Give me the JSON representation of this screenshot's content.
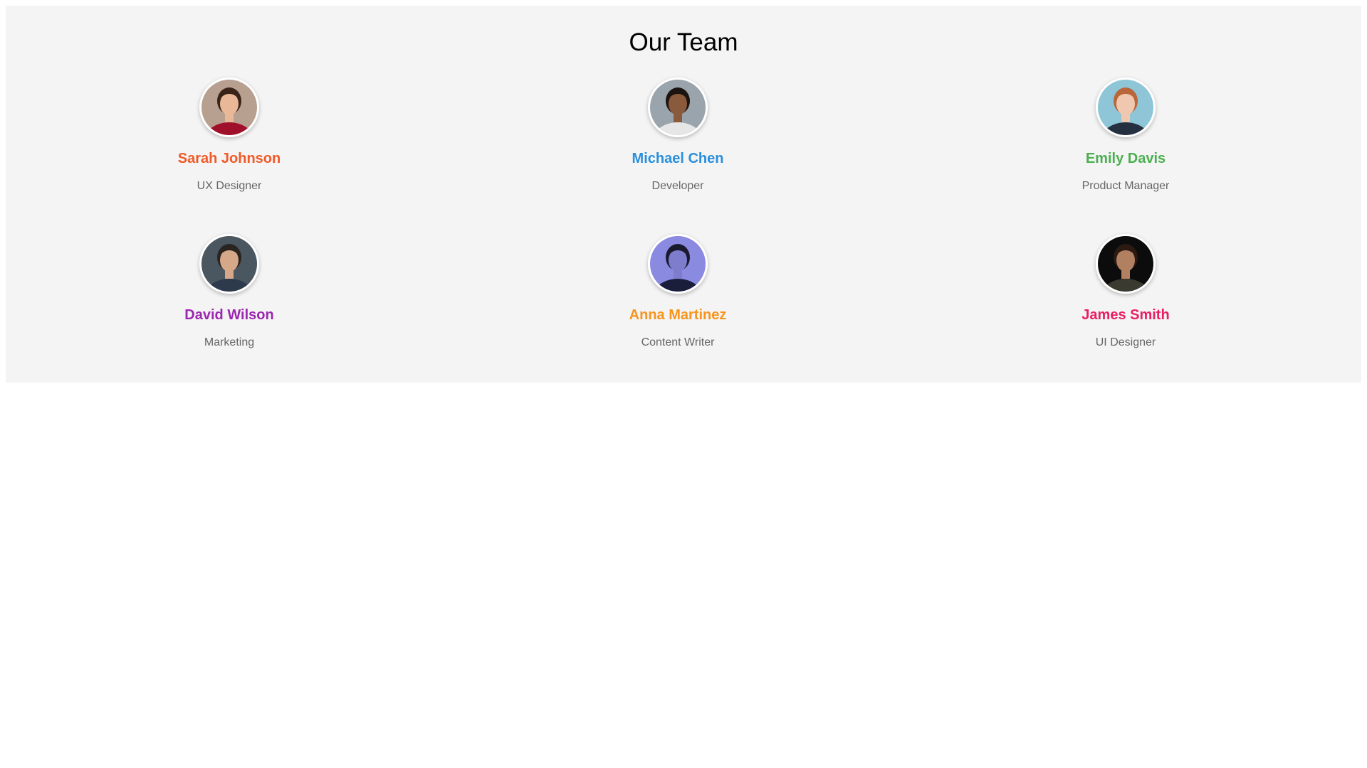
{
  "page": {
    "title": "Our Team"
  },
  "members": [
    {
      "name": "Sarah Johnson",
      "role": "UX Designer",
      "name_color": "#f05a28",
      "photo": {
        "bg": "#b8a090",
        "hair": "#3a2418",
        "skin": "#e8b898",
        "shirt": "#a0102a"
      }
    },
    {
      "name": "Michael Chen",
      "role": "Developer",
      "name_color": "#2a8fdc",
      "photo": {
        "bg": "#9aa4ac",
        "hair": "#1c1410",
        "skin": "#8a5a3c",
        "shirt": "#e6e6e6"
      }
    },
    {
      "name": "Emily Davis",
      "role": "Product Manager",
      "name_color": "#4caf50",
      "photo": {
        "bg": "#8ec6d8",
        "hair": "#b8663a",
        "skin": "#f0c8b0",
        "shirt": "#243040"
      }
    },
    {
      "name": "David Wilson",
      "role": "Marketing",
      "name_color": "#9c27b0",
      "photo": {
        "bg": "#4a5660",
        "hair": "#2a2420",
        "skin": "#d4a888",
        "shirt": "#2c3a4c"
      }
    },
    {
      "name": "Anna Martinez",
      "role": "Content Writer",
      "name_color": "#f7941d",
      "photo": {
        "bg": "#8a8ae0",
        "hair": "#1a1a2e",
        "skin": "#7e7ccc",
        "shirt": "#1a1e3a"
      }
    },
    {
      "name": "James Smith",
      "role": "UI Designer",
      "name_color": "#e91e63",
      "photo": {
        "bg": "#0c0c0c",
        "hair": "#2a1a12",
        "skin": "#b08060",
        "shirt": "#3a3a30"
      }
    }
  ]
}
